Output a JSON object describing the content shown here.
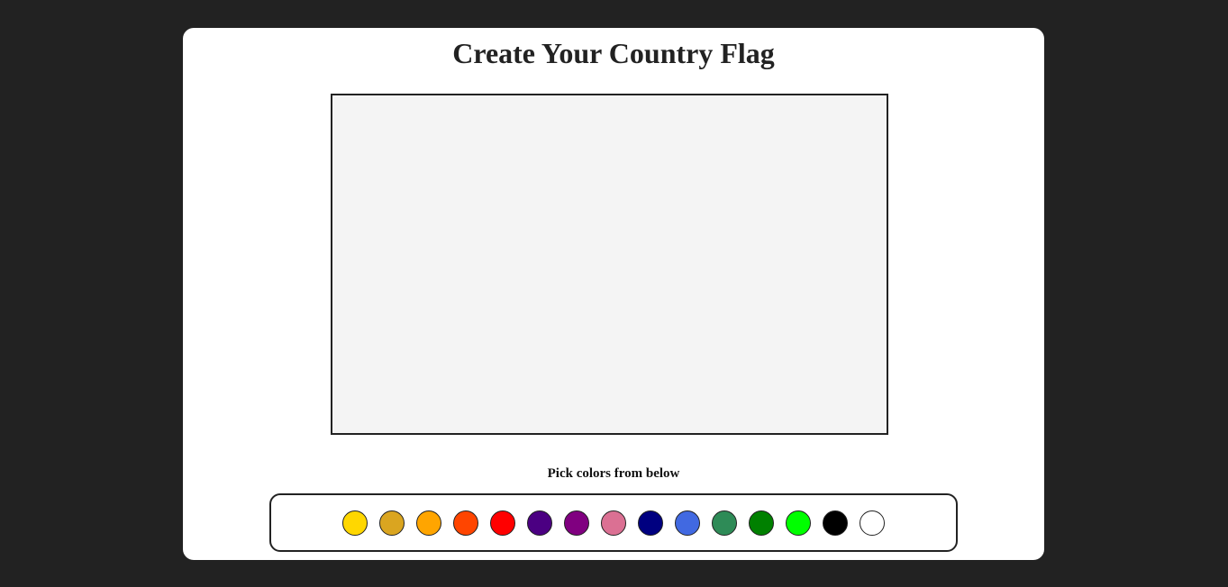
{
  "page": {
    "title": "Create Your Country Flag",
    "pick_label": "Pick colors from below"
  },
  "canvas": {
    "fill": "#f4f4f4",
    "border": "#222222"
  },
  "palette": {
    "colors": [
      "#FFD700",
      "#DAA520",
      "#FFA500",
      "#FF4500",
      "#FF0000",
      "#4B0082",
      "#800080",
      "#DB7093",
      "#000080",
      "#4169E1",
      "#2E8B57",
      "#008000",
      "#00FF00",
      "#000000",
      "#FFFFFF"
    ]
  },
  "theme": {
    "background": "#222222",
    "card": "#ffffff"
  }
}
